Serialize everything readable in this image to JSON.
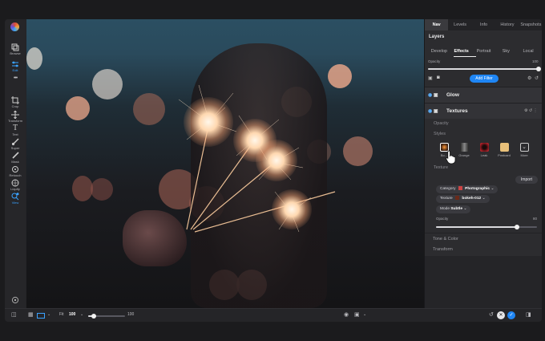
{
  "toolbar": {
    "tools": [
      {
        "label": "Browse",
        "icon": "browse-icon"
      },
      {
        "label": "Edit",
        "icon": "edit-sliders-icon",
        "active": true
      },
      {
        "label": "Crop",
        "icon": "crop-icon"
      },
      {
        "label": "Transform",
        "icon": "transform-icon"
      },
      {
        "label": "Text",
        "icon": "text-icon"
      },
      {
        "label": "Super",
        "icon": "brush-icon"
      },
      {
        "label": "Mask",
        "icon": "mask-icon"
      },
      {
        "label": "Retouch",
        "icon": "retouch-icon"
      },
      {
        "label": "Liquify",
        "icon": "liquify-icon"
      },
      {
        "label": "View",
        "icon": "view-icon",
        "active": true
      }
    ]
  },
  "panel": {
    "tabs": [
      "Nav",
      "Levels",
      "Info",
      "History",
      "Snapshots"
    ],
    "selected_tab": "Nav",
    "layers_title": "Layers",
    "subtabs": [
      "Develop",
      "Effects",
      "Portrait",
      "Sky",
      "Local"
    ],
    "selected_subtab": "Effects",
    "opacity_label": "Opacity",
    "opacity_value": "100",
    "add_filter_label": "Add Filter",
    "glow_label": "Glow",
    "textures_label": "Textures",
    "textures_opacity_label": "Opacity",
    "styles_label": "Styles",
    "styles": [
      {
        "label": "Bo...",
        "color": "#3a1e10"
      },
      {
        "label": "Grunge",
        "color": "#555"
      },
      {
        "label": "Leak",
        "color": "#b5212a"
      },
      {
        "label": "Postcard",
        "color": "#e8c07a"
      },
      {
        "label": "More",
        "color": "#2c2c2f"
      }
    ],
    "texture_label": "Texture",
    "import_label": "Import",
    "category_label": "Category",
    "category_value": "Photographic",
    "texture_field_label": "Texture",
    "texture_value": "bokeh-012",
    "mode_label": "Mode",
    "mode_value": "Subtle",
    "texture_opacity_label": "Opacity",
    "texture_opacity_value": "80",
    "texture_opacity_level": 0.8,
    "tone_color_label": "Tone & Color",
    "transform_label": "Transform"
  },
  "bottom": {
    "fit_label": "Fit",
    "zoom_value": "100",
    "zoom_max": "100"
  }
}
